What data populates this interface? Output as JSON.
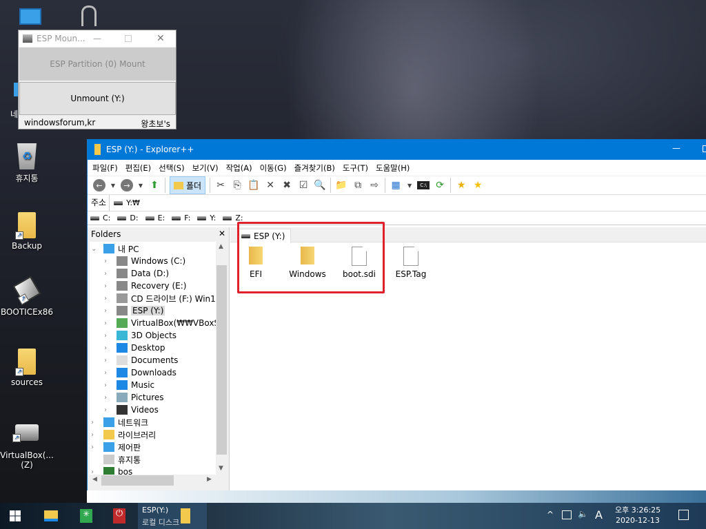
{
  "desktop": {
    "icons": [
      {
        "label": "휴지통"
      },
      {
        "label": "Backup"
      },
      {
        "label": "BOOTICEx86"
      },
      {
        "label": "sources"
      },
      {
        "label": "VirtualBox(...",
        "label2": "(Z)"
      }
    ],
    "partial_label": "네"
  },
  "esp_mount": {
    "title": "ESP Moun...",
    "mount_button": "ESP Partition (0) Mount",
    "unmount_button": "Unmount (Y:)",
    "footer_left": "windowsforum,kr",
    "footer_right": "왕초보's"
  },
  "explorer": {
    "title": "ESP (Y:) - Explorer++",
    "menu": [
      "파일(F)",
      "편집(E)",
      "선택(S)",
      "보기(V)",
      "작업(A)",
      "이동(G)",
      "즐겨찾기(B)",
      "도구(T)",
      "도움말(H)"
    ],
    "toolbar": {
      "folders_label": "폴더"
    },
    "address": {
      "label": "주소",
      "value": "Y:₩"
    },
    "drives": [
      "C:",
      "D:",
      "E:",
      "F:",
      "Y:",
      "Z:"
    ],
    "tree": {
      "header": "Folders",
      "root": "내 PC",
      "children": [
        "Windows (C:)",
        "Data (D:)",
        "Recovery (E:)",
        "CD 드라이브 (F:) Win1",
        "ESP (Y:)",
        "VirtualBox(₩₩VBoxSvr",
        "3D Objects",
        "Desktop",
        "Documents",
        "Downloads",
        "Music",
        "Pictures",
        "Videos"
      ],
      "top": [
        "네트워크",
        "라이브러리",
        "제어판",
        "휴지통",
        "bos"
      ],
      "selected": "ESP (Y:)"
    },
    "tab": "ESP (Y:)",
    "files": [
      {
        "name": "EFI",
        "type": "folder"
      },
      {
        "name": "Windows",
        "type": "folder"
      },
      {
        "name": "boot.sdi",
        "type": "file"
      },
      {
        "name": "ESP.Tag",
        "type": "file"
      }
    ],
    "highlight_color": "#e0202a"
  },
  "taskbar": {
    "time": "오후 3:26:25",
    "date": "2020-12-13",
    "tray_ime": "A",
    "task_label": "ESP(Y:)",
    "task_label2": "로컬 디스크"
  }
}
